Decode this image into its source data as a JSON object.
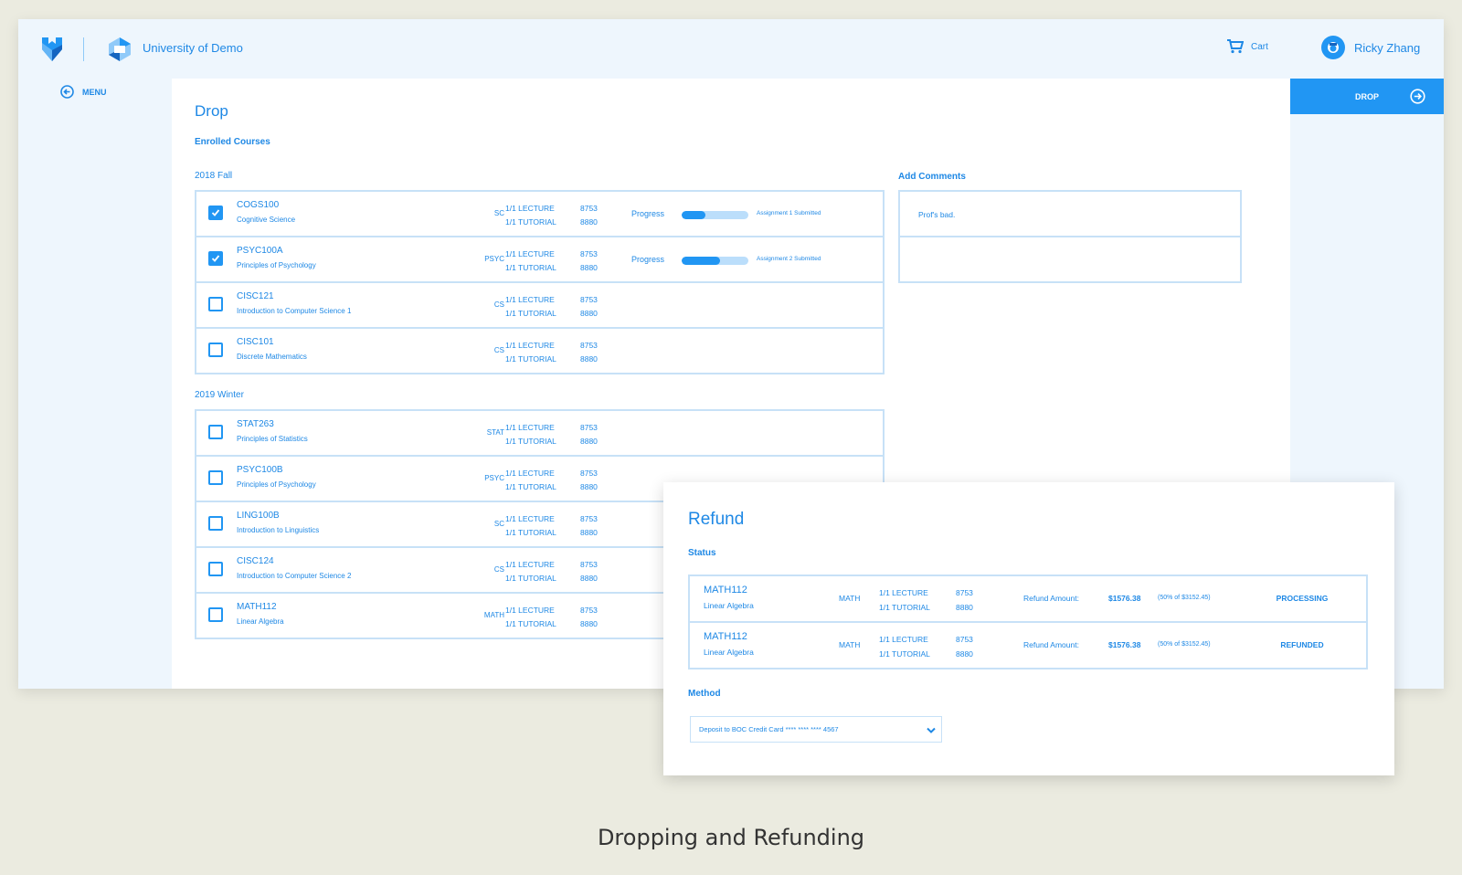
{
  "header": {
    "university": "University of Demo",
    "cart_label": "Cart",
    "user_name": "Ricky Zhang"
  },
  "sidebar": {
    "menu_label": "MENU"
  },
  "actions": {
    "drop_label": "DROP"
  },
  "drop": {
    "title": "Drop",
    "subtitle": "Enrolled Courses",
    "progress_label": "Progress",
    "terms": [
      {
        "name": "2018 Fall",
        "courses": [
          {
            "code": "COGS100",
            "name": "Cognitive Science",
            "dept": "SC",
            "lecture": "1/1 LECTURE",
            "tutorial": "1/1 TUTORIAL",
            "lec_sec": "8753",
            "tut_sec": "8880",
            "checked": true,
            "progress": 0.35,
            "note": "Assignment 1 Submitted"
          },
          {
            "code": "PSYC100A",
            "name": "Principles of Psychology",
            "dept": "PSYC",
            "lecture": "1/1 LECTURE",
            "tutorial": "1/1 TUTORIAL",
            "lec_sec": "8753",
            "tut_sec": "8880",
            "checked": true,
            "progress": 0.57,
            "note": "Assignment 2 Submitted"
          },
          {
            "code": "CISC121",
            "name": "Introduction to Computer Science 1",
            "dept": "CS",
            "lecture": "1/1 LECTURE",
            "tutorial": "1/1 TUTORIAL",
            "lec_sec": "8753",
            "tut_sec": "8880",
            "checked": false
          },
          {
            "code": "CISC101",
            "name": "Discrete Mathematics",
            "dept": "CS",
            "lecture": "1/1 LECTURE",
            "tutorial": "1/1 TUTORIAL",
            "lec_sec": "8753",
            "tut_sec": "8880",
            "checked": false
          }
        ]
      },
      {
        "name": "2019 Winter",
        "courses": [
          {
            "code": "STAT263",
            "name": "Principles of Statistics",
            "dept": "STAT",
            "lecture": "1/1 LECTURE",
            "tutorial": "1/1 TUTORIAL",
            "lec_sec": "8753",
            "tut_sec": "8880",
            "checked": false
          },
          {
            "code": "PSYC100B",
            "name": "Principles of Psychology",
            "dept": "PSYC",
            "lecture": "1/1 LECTURE",
            "tutorial": "1/1 TUTORIAL",
            "lec_sec": "8753",
            "tut_sec": "8880",
            "checked": false
          },
          {
            "code": "LING100B",
            "name": "Introduction to Linguistics",
            "dept": "SC",
            "lecture": "1/1 LECTURE",
            "tutorial": "1/1 TUTORIAL",
            "lec_sec": "8753",
            "tut_sec": "8880",
            "checked": false
          },
          {
            "code": "CISC124",
            "name": "Introduction to Computer Science 2",
            "dept": "CS",
            "lecture": "1/1 LECTURE",
            "tutorial": "1/1 TUTORIAL",
            "lec_sec": "8753",
            "tut_sec": "8880",
            "checked": false
          },
          {
            "code": "MATH112",
            "name": "Linear Algebra",
            "dept": "MATH",
            "lecture": "1/1 LECTURE",
            "tutorial": "1/1 TUTORIAL",
            "lec_sec": "8753",
            "tut_sec": "8880",
            "checked": false
          }
        ]
      }
    ]
  },
  "comments": {
    "label": "Add Comments",
    "entries": [
      "Prof's bad.",
      ""
    ]
  },
  "refund": {
    "title": "Refund",
    "status_label": "Status",
    "rows": [
      {
        "code": "MATH112",
        "name": "Linear Algebra",
        "dept": "MATH",
        "lecture": "1/1 LECTURE",
        "tutorial": "1/1 TUTORIAL",
        "lec_sec": "8753",
        "tut_sec": "8880",
        "amount_label": "Refund Amount:",
        "amount": "$1576.38",
        "percent": "(50% of $3152.45)",
        "status": "PROCESSING"
      },
      {
        "code": "MATH112",
        "name": "Linear Algebra",
        "dept": "MATH",
        "lecture": "1/1 LECTURE",
        "tutorial": "1/1 TUTORIAL",
        "lec_sec": "8753",
        "tut_sec": "8880",
        "amount_label": "Refund Amount:",
        "amount": "$1576.38",
        "percent": "(50% of $3152.45)",
        "status": "REFUNDED"
      }
    ],
    "method_label": "Method",
    "method_value": "Deposit to BOC Credit Card **** **** **** 4567"
  },
  "caption": "Dropping and Refunding",
  "colors": {
    "accent": "#2196f3",
    "row_border": "#c7e1f7",
    "sidebar_bg": "#eef6fd",
    "page_bg": "#ebebe0"
  },
  "icons": [
    "app-logo-icon",
    "university-logo-icon",
    "cart-icon",
    "user-avatar-icon",
    "back-arrow-icon",
    "arrow-right-circle-icon",
    "checkmark-icon",
    "chevron-down-icon"
  ]
}
